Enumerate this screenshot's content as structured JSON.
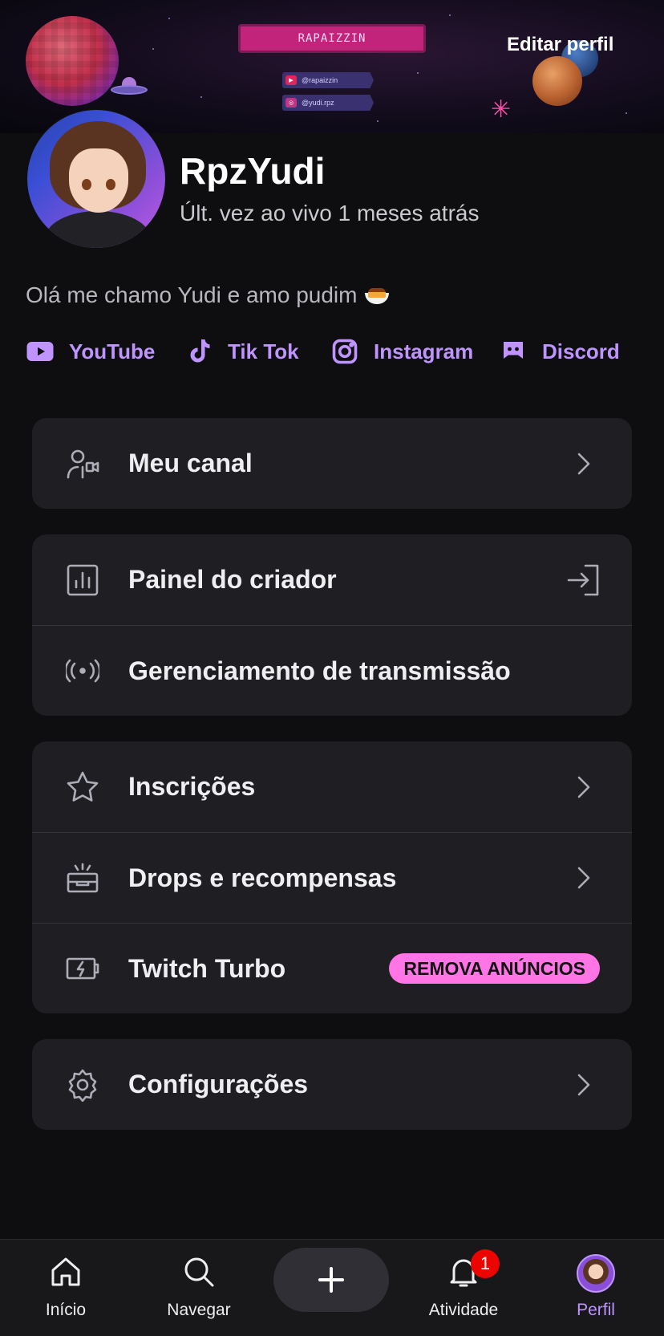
{
  "banner": {
    "tag": "RAPAIZZIN",
    "socials": [
      {
        "handle": "@rapaizzin",
        "icon": "youtube-icon"
      },
      {
        "handle": "@yudi.rpz",
        "icon": "instagram-icon"
      }
    ]
  },
  "header": {
    "edit_profile_label": "Editar perfil"
  },
  "profile": {
    "username": "RpzYudi",
    "last_live": "Últ. vez ao vivo 1 meses atrás",
    "bio": "Olá me chamo Yudi e amo pudim",
    "bio_emoji": "pudding-icon"
  },
  "socials": [
    {
      "label": "YouTube",
      "icon": "youtube-icon"
    },
    {
      "label": "Tik Tok",
      "icon": "tiktok-icon"
    },
    {
      "label": "Instagram",
      "icon": "instagram-icon"
    },
    {
      "label": "Discord",
      "icon": "discord-icon"
    }
  ],
  "menu": {
    "my_channel": {
      "label": "Meu canal",
      "icon": "channel-icon"
    },
    "creator_dashboard": {
      "label": "Painel do criador",
      "icon": "dashboard-icon"
    },
    "stream_manager": {
      "label": "Gerenciamento de transmissão",
      "icon": "broadcast-icon"
    },
    "subscriptions": {
      "label": "Inscrições",
      "icon": "star-icon"
    },
    "drops": {
      "label": "Drops e recompensas",
      "icon": "gift-box-icon"
    },
    "turbo": {
      "label": "Twitch Turbo",
      "icon": "battery-bolt-icon",
      "badge": "REMOVA ANÚNCIOS"
    },
    "settings": {
      "label": "Configurações",
      "icon": "gear-icon"
    }
  },
  "nav": {
    "home": "Início",
    "browse": "Navegar",
    "activity": "Atividade",
    "activity_badge": "1",
    "profile": "Perfil"
  },
  "colors": {
    "accent": "#bf94ff",
    "background": "#0e0e10",
    "card": "#1f1f23",
    "badge": "#ff75e6",
    "notification": "#eb0400"
  }
}
